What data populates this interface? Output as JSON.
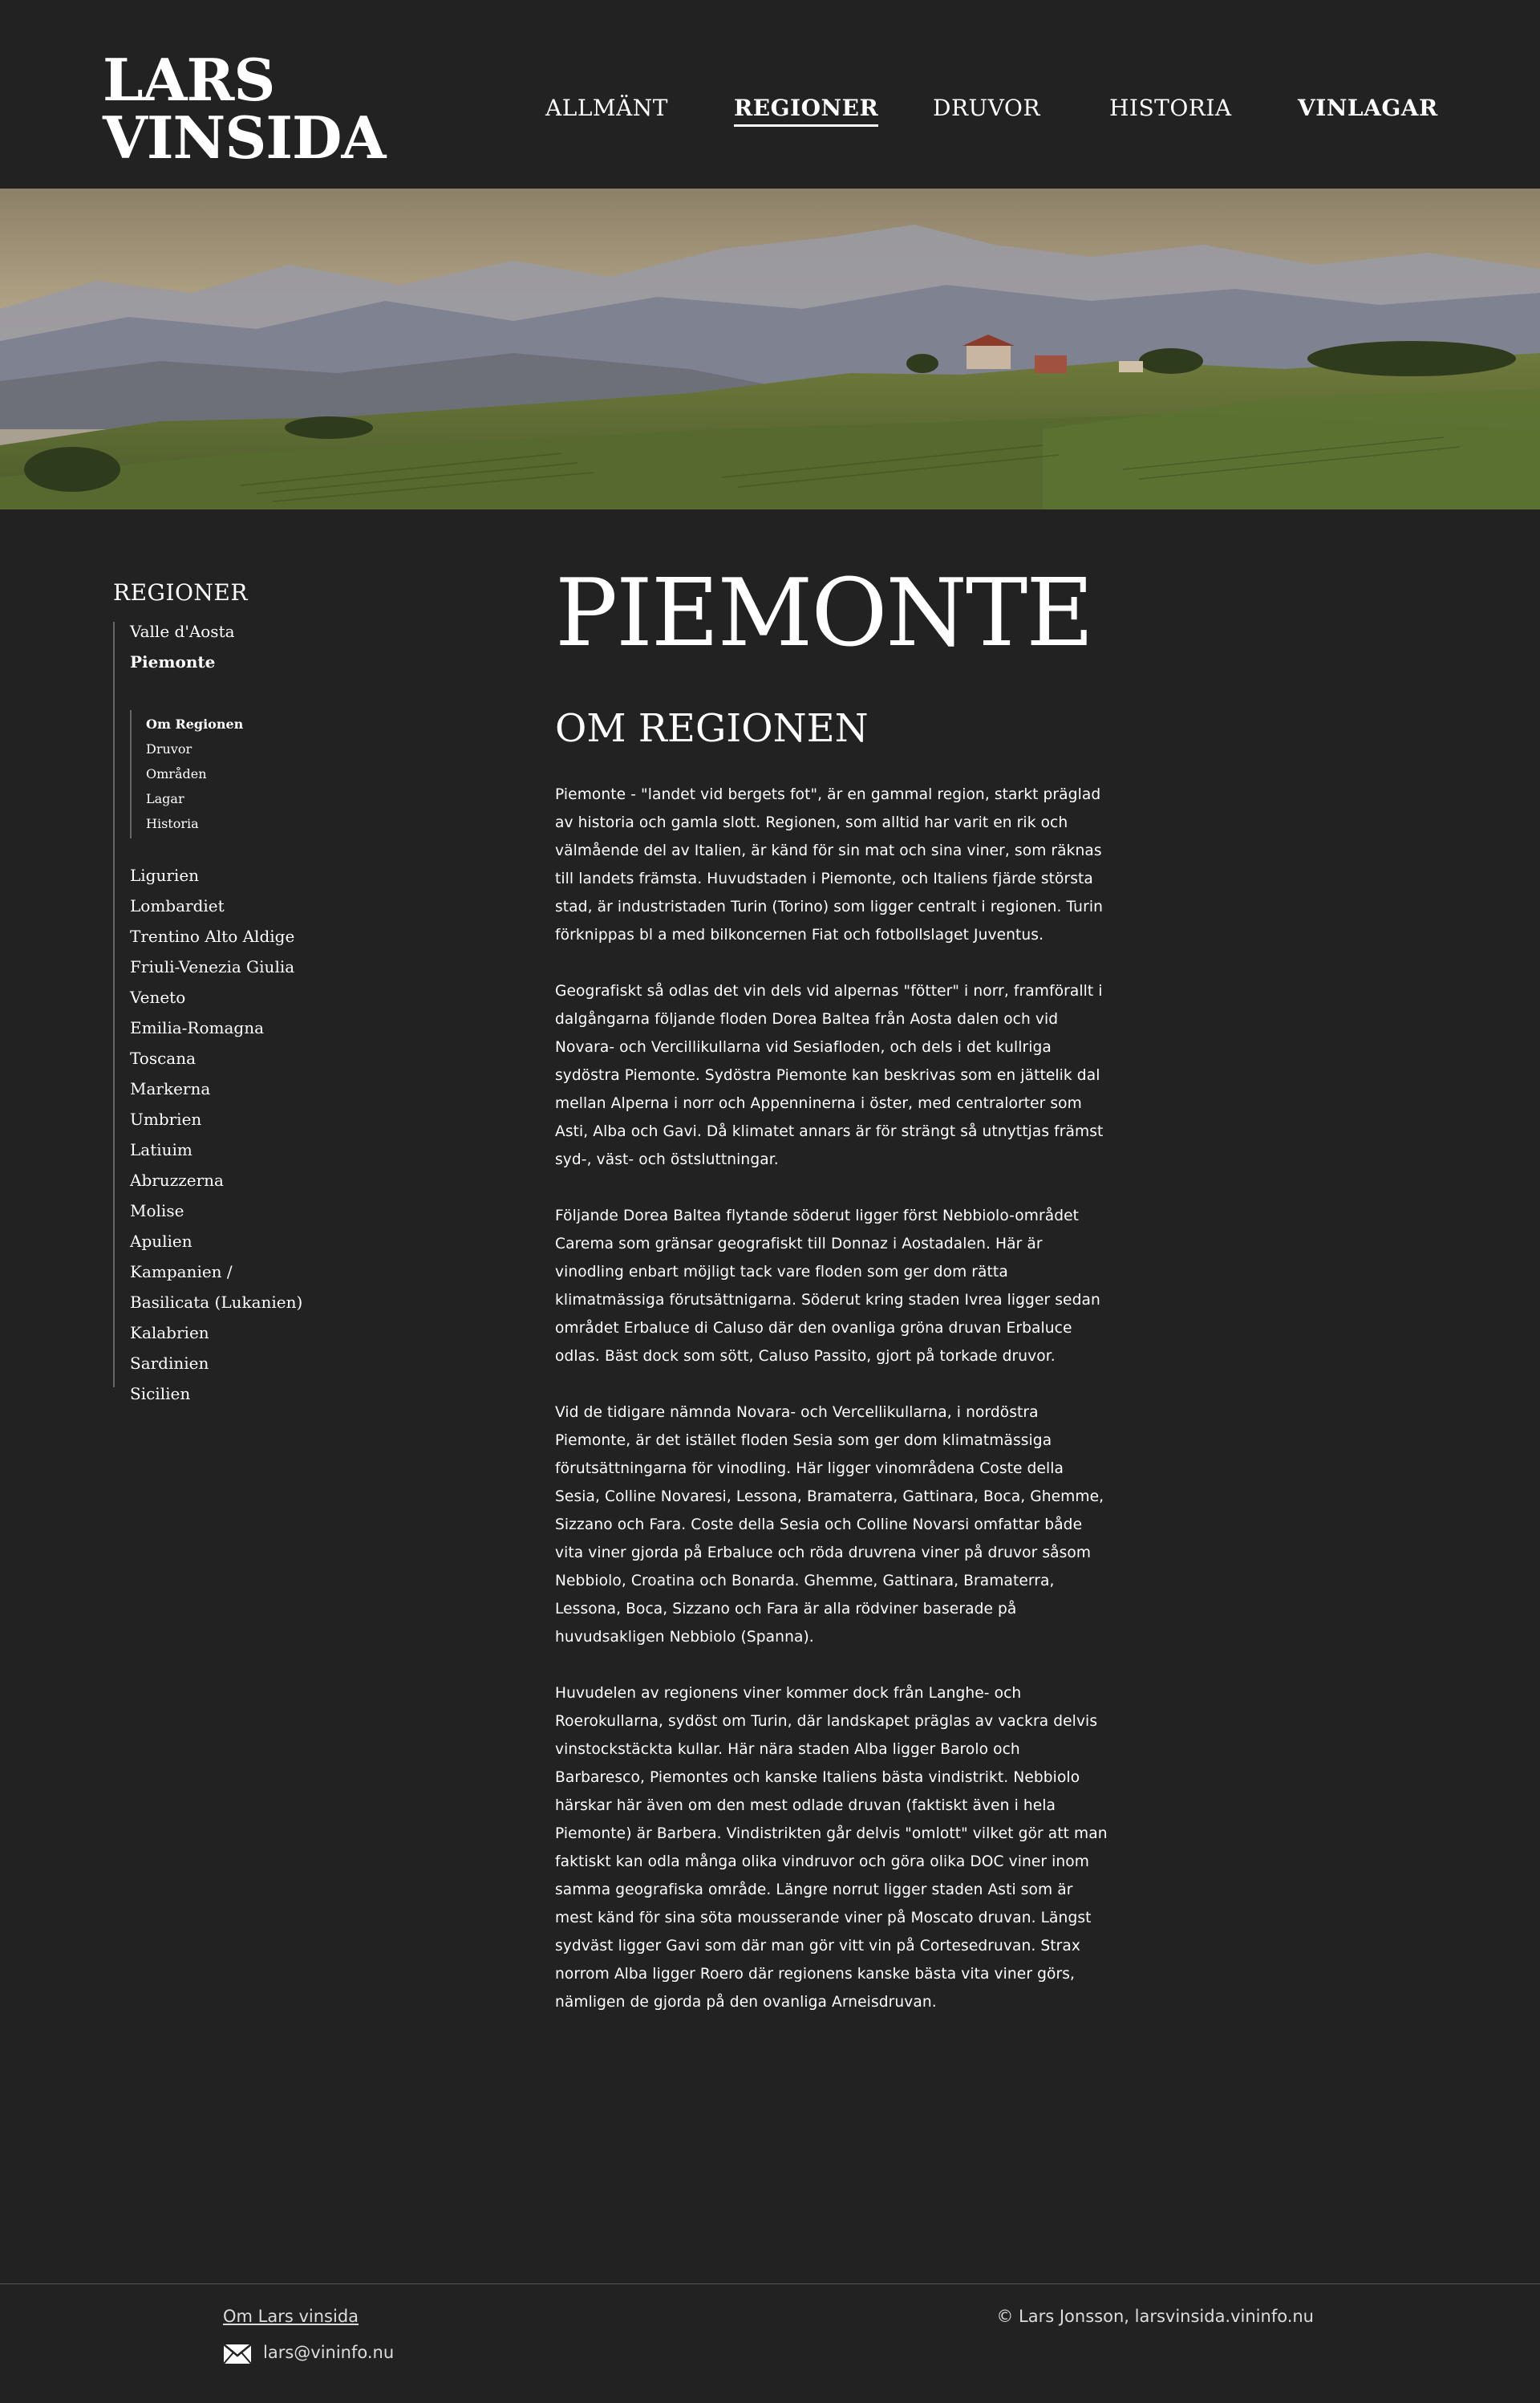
{
  "header": {
    "logo_line1": "LARS",
    "logo_line2": "VINSIDA",
    "nav": [
      {
        "label": "ALLMÄNT"
      },
      {
        "label": "REGIONER"
      },
      {
        "label": "DRUVOR"
      },
      {
        "label": "HISTORIA"
      },
      {
        "label": "VINLAGAR"
      }
    ]
  },
  "sidebar": {
    "title": "REGIONER",
    "regions_before": [
      "Valle d'Aosta",
      "Piemonte"
    ],
    "current_region": "Piemonte",
    "subnav": [
      "Om Regionen",
      "Druvor",
      "Områden",
      "Lagar",
      "Historia"
    ],
    "current_sub": "Om Regionen",
    "regions_after": [
      "Ligurien",
      "Lombardiet",
      " Trentino Alto Aldige",
      "Friuli-Venezia Giulia",
      "Veneto",
      "Emilia-Romagna",
      "Toscana",
      "Markerna",
      "Umbrien",
      "Latiuim",
      "Abruzzerna",
      "Molise",
      "Apulien",
      "Kampanien /",
      "Basilicata (Lukanien)",
      "Kalabrien",
      "Sardinien",
      "Sicilien"
    ]
  },
  "main": {
    "title": "PIEMONTE",
    "section_title": "OM REGIONEN",
    "paragraphs": [
      "Piemonte - \"landet vid bergets fot\", är en gammal region, starkt präglad av historia och gamla slott.  Regionen, som alltid har varit en rik och välmående del av Italien, är känd för sin mat och sina viner, som räknas till landets främsta.  Huvudstaden i Piemonte, och Italiens fjärde största stad, är industristaden Turin (Torino) som ligger centralt i regionen.  Turin förknippas bl a med bilkoncernen Fiat och fotbollslaget Juventus.",
      "Geografiskt så odlas det vin dels vid alpernas \"fötter\" i norr, framförallt i dalgångarna följande floden Dorea Baltea från Aosta dalen och vid Novara- och Vercillikullarna vid Sesiafloden, och dels i det kullriga sydöstra Piemonte.  Sydöstra Piemonte kan beskrivas som en jättelik dal mellan Alperna i norr och Appenninerna i öster, med centralorter som Asti, Alba och Gavi.  Då klimatet annars är för strängt så utnyttjas främst syd-, väst- och östsluttningar.",
      "Följande Dorea Baltea flytande söderut ligger först Nebbiolo-området Carema som gränsar geografiskt till Donnaz i Aostadalen.  Här är vinodling enbart möjligt tack vare floden som ger dom rätta klimatmässiga förutsättnigarna.  Söderut kring staden Ivrea ligger sedan området Erbaluce di Caluso där den ovanliga gröna druvan Erbaluce odlas.  Bäst dock som sött, Caluso Passito, gjort på torkade druvor.",
      "Vid de tidigare nämnda Novara- och Vercellikullarna, i nordöstra Piemonte, är det istället floden Sesia som ger dom klimatmässiga förutsättningarna för vinodling.  Här ligger vinområdena Coste della Sesia, Colline Novaresi, Lessona, Bramaterra, Gattinara, Boca, Ghemme, Sizzano och Fara.  Coste della Sesia och Colline Novarsi omfattar både vita viner gjorda på Erbaluce och röda druvrena viner på druvor såsom Nebbiolo, Croatina och Bonarda.  Ghemme, Gattinara, Bramaterra, Lessona, Boca, Sizzano och Fara är alla rödviner baserade på huvudsakligen Nebbiolo (Spanna).",
      "Huvudelen av regionens viner kommer dock från Langhe- och Roerokullarna, sydöst om Turin, där landskapet präglas av vackra delvis vinstockstäckta kullar.  Här nära staden Alba ligger Barolo och Barbaresco, Piemontes och kanske Italiens bästa vindistrikt.  Nebbiolo härskar här även om den mest odlade druvan (faktiskt även i hela Piemonte) är Barbera.  Vindistrikten går delvis \"omlott\" vilket gör att man faktiskt kan odla många olika vindruvor och göra olika DOC viner inom samma geografiska område.  Längre norrut ligger staden Asti som är mest känd för sina söta mousserande viner på Moscato druvan.  Längst sydväst ligger Gavi som där man gör vitt vin på Cortesedruvan.  Strax norrom Alba ligger Roero där regionens kanske bästa vita viner görs, nämligen de gjorda på den ovanliga Arneisdruvan."
    ]
  },
  "footer": {
    "about_link": "Om Lars vinsida",
    "email": "lars@vininfo.nu",
    "copyright": "© Lars Jonsson, larsvinsida.vininfo.nu"
  },
  "icons": {
    "mail": "envelope-icon"
  },
  "colors": {
    "background": "#222222",
    "text": "#ffffff",
    "divider": "#666666"
  }
}
